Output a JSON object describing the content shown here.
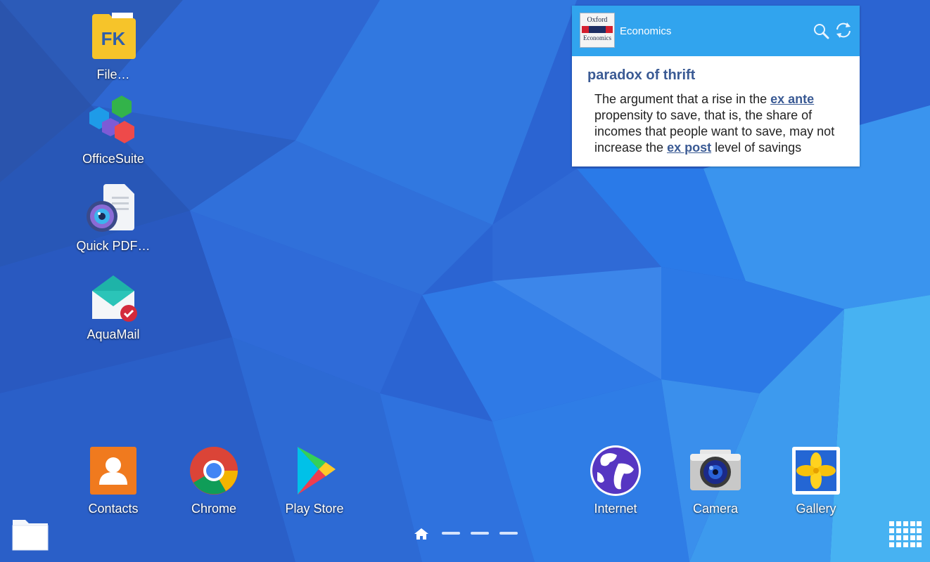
{
  "desktop_apps": [
    {
      "name": "file-commander",
      "label": "File…",
      "icon": "file-commander-icon"
    },
    {
      "name": "officesuite",
      "label": "OfficeSuite",
      "icon": "officesuite-icon"
    },
    {
      "name": "quick-pdf",
      "label": "Quick PDF…",
      "icon": "quick-pdf-scanner-icon"
    },
    {
      "name": "aquamail",
      "label": "AquaMail",
      "icon": "aquamail-icon"
    }
  ],
  "widget": {
    "source": "Economics",
    "logo_line1": "Oxford",
    "logo_line2": "Economics",
    "term": "paradox of thrift",
    "definition_parts": {
      "p1": "The argument that a rise in the ",
      "link1": "ex ante",
      "p2": " propensity to save, that is, the share of incomes that people want to save, may not increase the ",
      "link2": "ex post",
      "p3": " level of savings"
    },
    "search_icon": "search-icon",
    "refresh_icon": "refresh-icon"
  },
  "dock_left": [
    {
      "label": "Contacts",
      "icon": "contacts-icon"
    },
    {
      "label": "Chrome",
      "icon": "chrome-icon"
    },
    {
      "label": "Play Store",
      "icon": "play-store-icon"
    }
  ],
  "dock_right": [
    {
      "label": "Internet",
      "icon": "internet-globe-icon"
    },
    {
      "label": "Camera",
      "icon": "camera-icon"
    },
    {
      "label": "Gallery",
      "icon": "gallery-icon"
    }
  ],
  "page_indicator": {
    "home_icon": "home-icon",
    "pages": 3,
    "current": "home"
  },
  "bottom_left_icon": "folder-icon",
  "bottom_right_icon": "apps-grid-icon"
}
